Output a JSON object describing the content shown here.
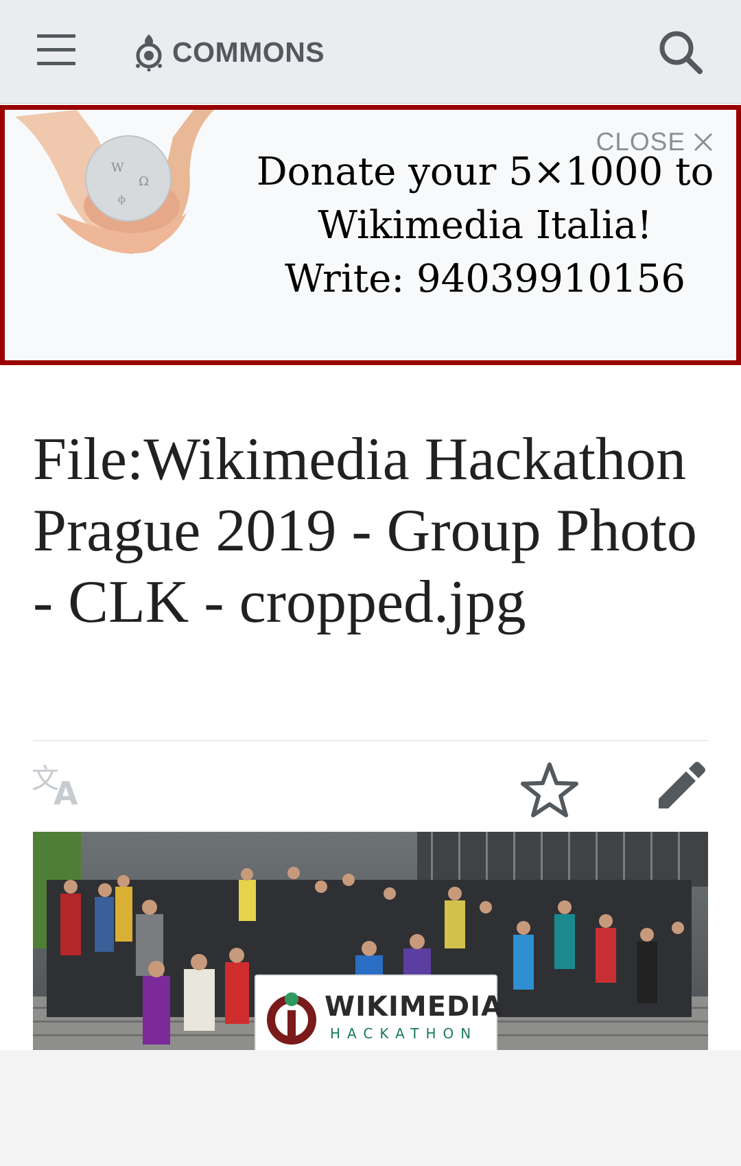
{
  "header": {
    "menu_icon": "hamburger-menu-icon",
    "logo_text": "COMMONS",
    "logo_icon": "wikimedia-commons-logo",
    "search_icon": "search-icon"
  },
  "banner": {
    "image": "hands-holding-wikipedia-globe",
    "close_label": "CLOSE",
    "close_icon": "close-x-icon",
    "line1": "Donate your 5×1000 to",
    "line2": "Wikimedia Italia!",
    "line3": "Write: 94039910156",
    "border_color": "#990000"
  },
  "page": {
    "title": "File:Wikimedia Hackathon Prague 2019 - Group Photo - CLK - cropped.jpg",
    "language_icon": "language-icon",
    "watch_icon": "star-icon",
    "edit_icon": "pencil-edit-icon"
  },
  "photo": {
    "sign_word": "WIKIMEDIA",
    "sign_sub": "HACKATHON"
  }
}
